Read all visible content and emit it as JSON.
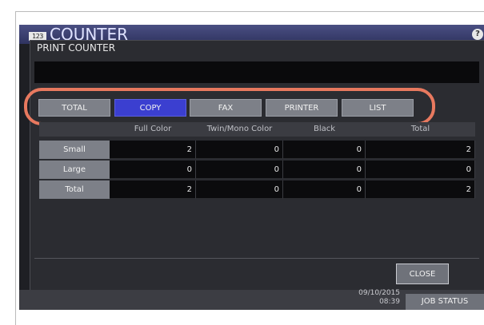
{
  "header": {
    "badge": "123",
    "title": "COUNTER",
    "help": "?"
  },
  "dialog": {
    "title": "PRINT COUNTER",
    "message": ""
  },
  "tabs": [
    {
      "label": "TOTAL",
      "active": false
    },
    {
      "label": "COPY",
      "active": true
    },
    {
      "label": "FAX",
      "active": false
    },
    {
      "label": "PRINTER",
      "active": false
    },
    {
      "label": "LIST",
      "active": false
    }
  ],
  "table": {
    "columns": [
      "Full Color",
      "Twin/Mono Color",
      "Black",
      "Total"
    ],
    "rows": [
      {
        "label": "Small",
        "values": [
          "2",
          "0",
          "0",
          "2"
        ]
      },
      {
        "label": "Large",
        "values": [
          "0",
          "0",
          "0",
          "0"
        ]
      },
      {
        "label": "Total",
        "values": [
          "2",
          "0",
          "0",
          "2"
        ]
      }
    ]
  },
  "buttons": {
    "close": "CLOSE"
  },
  "status": {
    "date": "09/10/2015",
    "time": "08:39",
    "job_status": "JOB STATUS"
  },
  "colors": {
    "highlight": "#e8795f",
    "active_tab": "#3b3fd0"
  }
}
